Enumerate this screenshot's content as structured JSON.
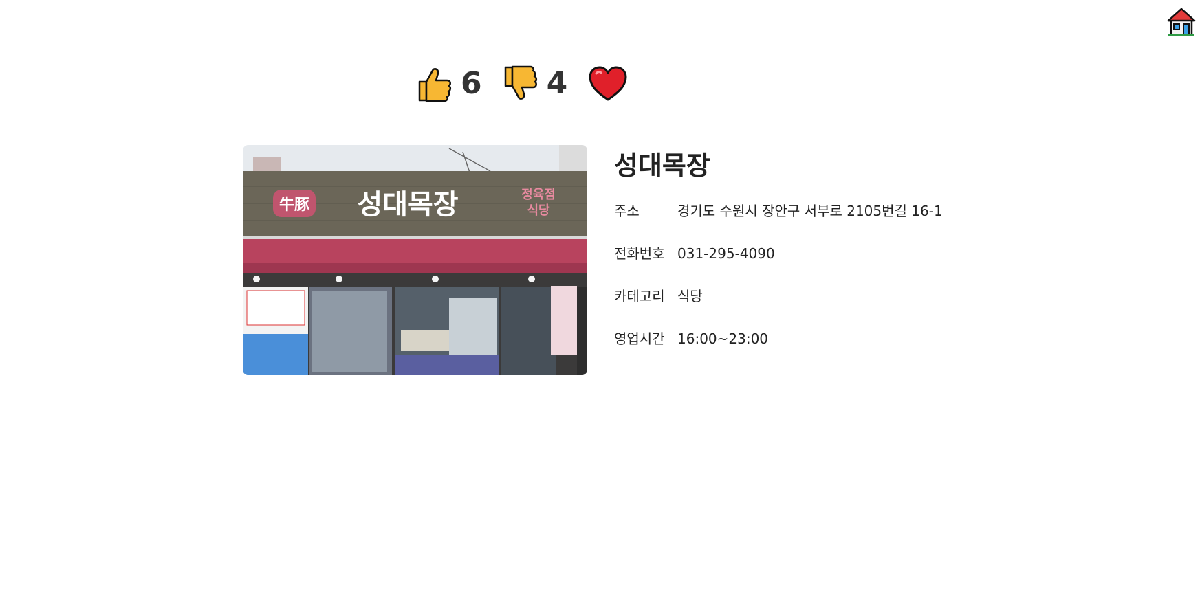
{
  "nav": {
    "home_icon": "house-icon"
  },
  "reactions": {
    "like": {
      "icon": "thumbs-up-icon",
      "count": "6"
    },
    "dislike": {
      "icon": "thumbs-down-icon",
      "count": "4"
    },
    "favorite": {
      "icon": "heart-icon"
    }
  },
  "restaurant": {
    "name": "성대목장",
    "photo_sign": {
      "main": "성대목장",
      "badge": "牛豚",
      "side_top": "정육점",
      "side_bottom": "식당"
    },
    "details": [
      {
        "label": "주소",
        "value": "경기도 수원시 장안구 서부로 2105번길 16-1"
      },
      {
        "label": "전화번호",
        "value": "031-295-4090"
      },
      {
        "label": "카테고리",
        "value": "식당"
      },
      {
        "label": "영업시간",
        "value": "16:00~23:00"
      }
    ]
  },
  "colors": {
    "thumb_yellow": "#f7b733",
    "heart_red": "#e0202a",
    "awning": "#b8435e",
    "sign_board": "#6b6658"
  }
}
